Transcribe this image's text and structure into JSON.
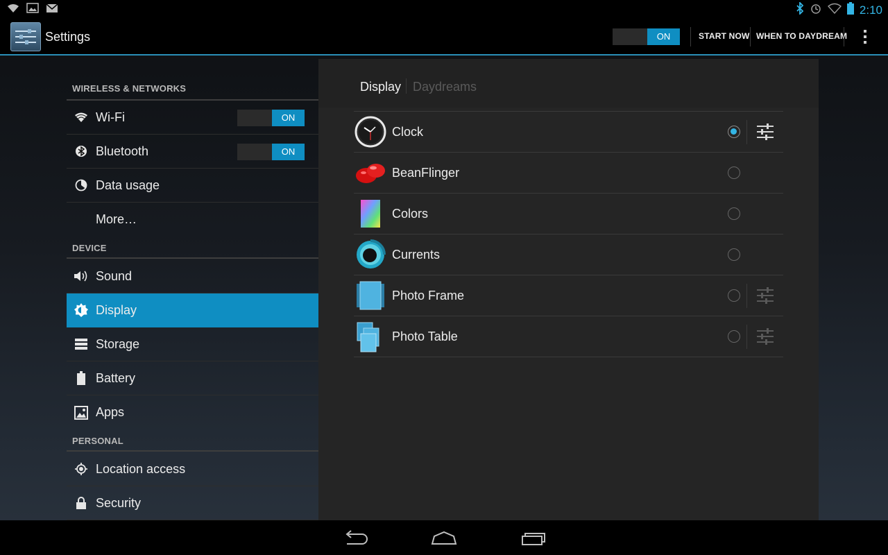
{
  "status_bar": {
    "time": "2:10",
    "left_icons": [
      "wifi-notification-icon",
      "image-icon",
      "mail-icon"
    ],
    "right_icons": [
      "bluetooth-icon",
      "alarm-icon",
      "wifi-icon",
      "battery-icon"
    ]
  },
  "action_bar": {
    "title": "Settings",
    "daydream_switch": "ON",
    "start_now": "START NOW",
    "when_to_daydream": "WHEN TO DAYDREAM"
  },
  "sidebar": {
    "sections": [
      {
        "header": "WIRELESS & NETWORKS",
        "items": [
          {
            "label": "Wi-Fi",
            "icon": "wifi-icon",
            "switch": "ON"
          },
          {
            "label": "Bluetooth",
            "icon": "bluetooth-icon",
            "switch": "ON"
          },
          {
            "label": "Data usage",
            "icon": "data-usage-icon"
          },
          {
            "label": "More…",
            "icon": ""
          }
        ]
      },
      {
        "header": "DEVICE",
        "items": [
          {
            "label": "Sound",
            "icon": "speaker-icon"
          },
          {
            "label": "Display",
            "icon": "brightness-icon",
            "selected": true
          },
          {
            "label": "Storage",
            "icon": "storage-icon"
          },
          {
            "label": "Battery",
            "icon": "battery-icon"
          },
          {
            "label": "Apps",
            "icon": "apps-icon"
          }
        ]
      },
      {
        "header": "PERSONAL",
        "items": [
          {
            "label": "Location access",
            "icon": "location-icon"
          },
          {
            "label": "Security",
            "icon": "lock-icon"
          }
        ]
      }
    ]
  },
  "main": {
    "breadcrumb": [
      "Display",
      "Daydreams"
    ],
    "daydreams": [
      {
        "label": "Clock",
        "icon": "clock-icon",
        "selected": true,
        "settings": "enabled"
      },
      {
        "label": "BeanFlinger",
        "icon": "jellybean-icon",
        "selected": false
      },
      {
        "label": "Colors",
        "icon": "colors-icon",
        "selected": false
      },
      {
        "label": "Currents",
        "icon": "currents-icon",
        "selected": false
      },
      {
        "label": "Photo Frame",
        "icon": "photo-frame-icon",
        "selected": false,
        "settings": "disabled"
      },
      {
        "label": "Photo Table",
        "icon": "photo-table-icon",
        "selected": false,
        "settings": "disabled"
      }
    ]
  },
  "nav_bar": {
    "buttons": [
      "back-icon",
      "home-icon",
      "recent-apps-icon"
    ]
  },
  "colors": {
    "accent": "#33b5e5",
    "selected_row": "#0f8ec2",
    "switch_on": "#0f8ec2"
  }
}
